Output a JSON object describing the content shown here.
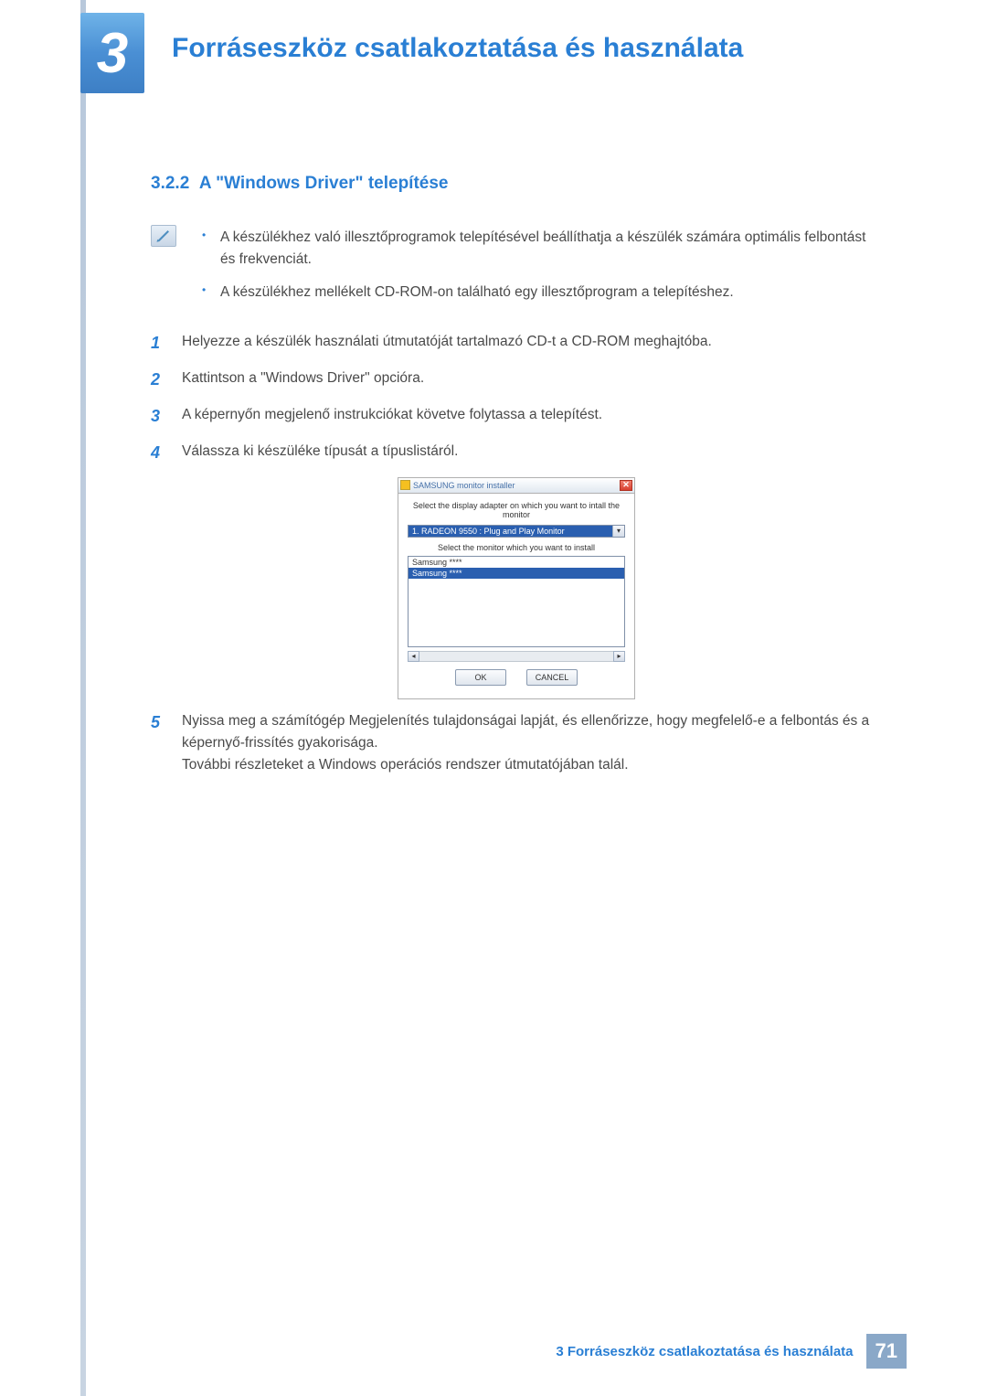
{
  "chapter": {
    "number": "3",
    "title": "Forráseszköz csatlakoztatása és használata"
  },
  "section": {
    "number": "3.2.2",
    "title": "A \"Windows Driver\" telepítése"
  },
  "notes": [
    "A készülékhez való illesztőprogramok telepítésével beállíthatja a készülék számára optimális felbontást és frekvenciát.",
    "A készülékhez mellékelt CD-ROM-on található egy illesztőprogram a telepítéshez."
  ],
  "steps": {
    "s1": {
      "num": "1",
      "text": "Helyezze a készülék használati útmutatóját tartalmazó CD-t a CD-ROM meghajtóba."
    },
    "s2": {
      "num": "2",
      "text": "Kattintson a \"Windows Driver\" opcióra."
    },
    "s3": {
      "num": "3",
      "text": "A képernyőn megjelenő instrukciókat követve folytassa a telepítést."
    },
    "s4": {
      "num": "4",
      "text": "Válassza ki készüléke típusát a típuslistáról."
    },
    "s5": {
      "num": "5",
      "text": "Nyissa meg a számítógép Megjelenítés tulajdonságai lapját, és ellenőrizze, hogy megfelelő-e a felbontás és a képernyő-frissítés gyakorisága."
    },
    "s5b": "További részleteket a Windows operációs rendszer útmutatójában talál."
  },
  "installer": {
    "title": "SAMSUNG monitor installer",
    "label_adapter": "Select the display adapter on which you want to intall the monitor",
    "adapter_value": "1. RADEON 9550 : Plug and Play Monitor",
    "label_monitor": "Select the monitor which you want to install",
    "list": {
      "item0": "Samsung ****",
      "item1": "Samsung ****"
    },
    "ok": "OK",
    "cancel": "CANCEL"
  },
  "footer": {
    "text": "3 Forráseszköz csatlakoztatása és használata",
    "page": "71"
  }
}
